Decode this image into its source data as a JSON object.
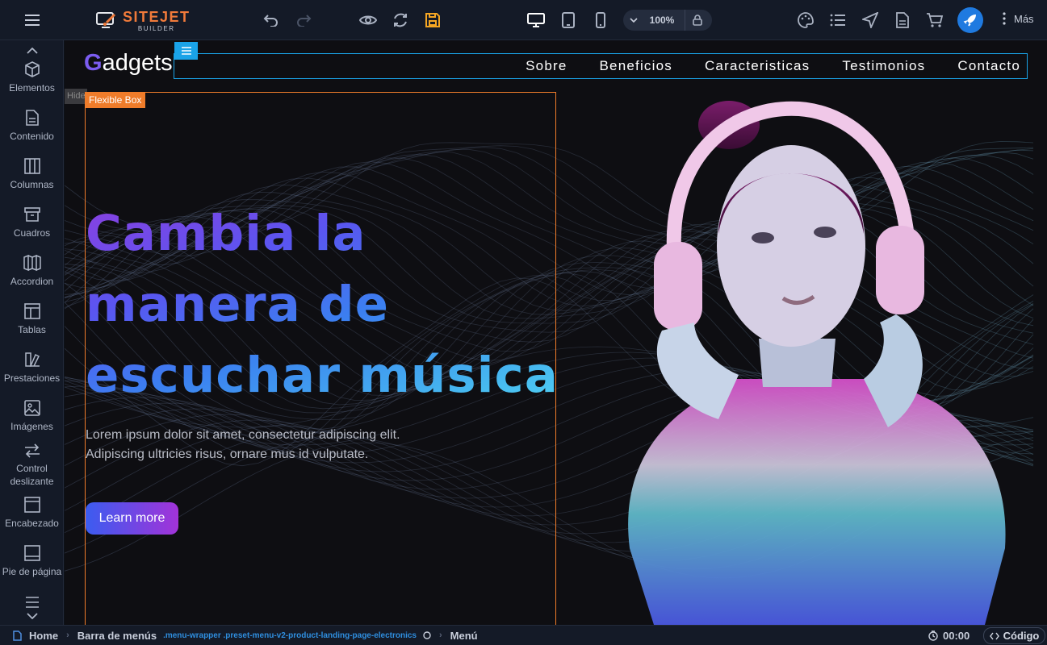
{
  "app": {
    "logo_main": "SITEJET",
    "logo_sub": "BUILDER",
    "zoom_value": "100%",
    "more_label": "Más"
  },
  "sidebar": {
    "items": [
      {
        "label": "Elementos",
        "icon": "cube-icon"
      },
      {
        "label": "Contenido",
        "icon": "document-icon"
      },
      {
        "label": "Columnas",
        "icon": "columns-icon"
      },
      {
        "label": "Cuadros",
        "icon": "box-icon"
      },
      {
        "label": "Accordion",
        "icon": "accordion-icon"
      },
      {
        "label": "Tablas",
        "icon": "table-icon"
      },
      {
        "label": "Prestaciones",
        "icon": "features-icon"
      },
      {
        "label": "Imágenes",
        "icon": "image-icon"
      },
      {
        "label": "Control deslizante",
        "icon": "slider-icon"
      },
      {
        "label": "Encabezado",
        "icon": "header-icon"
      },
      {
        "label": "Pie de página",
        "icon": "footer-icon"
      }
    ]
  },
  "canvas": {
    "brand_initial": "G",
    "brand_rest": "adgets",
    "nav": [
      "Sobre",
      "Beneficios",
      "Caracteristicas",
      "Testimonios",
      "Contacto"
    ],
    "hide_tag": "Hide",
    "flex_tag": "Flexible Box",
    "headline_lines": [
      "Cambia la",
      "manera de",
      "escuchar música"
    ],
    "lead_lines": [
      "Lorem ipsum dolor sit amet, consectetur adipiscing elit.",
      "Adipiscing ultricies risus, ornare mus id vulputate."
    ],
    "cta_label": "Learn more"
  },
  "breadcrumb": {
    "home": "Home",
    "menubar": "Barra de menús",
    "classes": ".menu-wrapper .preset-menu-v2-product-landing-page-electronics",
    "menu": "Menú"
  },
  "status": {
    "timer": "00:00",
    "code_label": "Código"
  },
  "colors": {
    "accent_orange": "#ef7c2a",
    "accent_blue": "#1aa3e8",
    "cta_gradient_start": "#3b5cf0",
    "cta_gradient_end": "#a233d8"
  }
}
